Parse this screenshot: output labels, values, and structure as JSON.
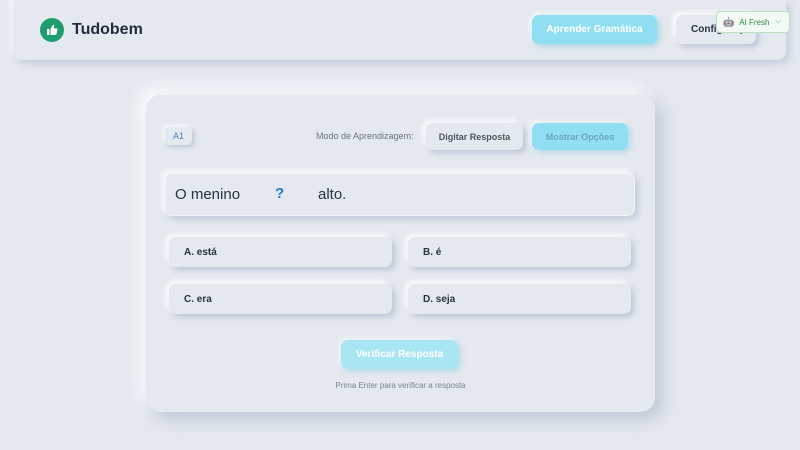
{
  "header": {
    "brand": "Tudobem",
    "primary_button": "Aprender Gramática",
    "config_button": "Configurações",
    "ai_badge": "AI Fresh"
  },
  "exercise": {
    "level": "A1",
    "mode_label": "Modo de Aprendizagem:",
    "mode_type": "Digitar Resposta",
    "mode_options": "Mostrar Opções",
    "sentence_start": "O menino",
    "blank": "?",
    "sentence_end": "alto.",
    "options": [
      {
        "label": "A. está"
      },
      {
        "label": "B. é"
      },
      {
        "label": "C. era"
      },
      {
        "label": "D. seja"
      }
    ],
    "verify_button": "Verificar Resposta",
    "hint": "Prima Enter para verificar a resposta"
  },
  "colors": {
    "background": "#e4e8ef",
    "accent": "#8fdef1",
    "brand_green": "#1f9d6e",
    "blank_blue": "#1e7fc0"
  },
  "icons": {
    "logo": "thumbs-up-icon",
    "ai": "robot-icon",
    "dropdown": "chevron-down-icon"
  }
}
